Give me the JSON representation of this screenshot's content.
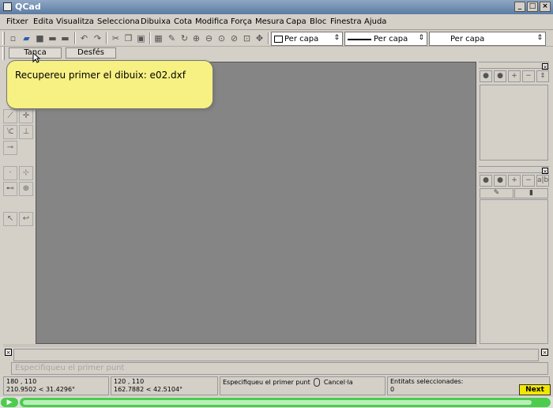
{
  "window": {
    "title": "QCad"
  },
  "menu": [
    "Fitxer",
    "Edita",
    "Visualitza",
    "Selecciona",
    "Dibuixa",
    "Cota",
    "Modifica",
    "Força",
    "Mesura",
    "Capa",
    "Bloc",
    "Finestra",
    "Ajuda"
  ],
  "toolbar": {
    "color_combo": "Per capa",
    "linetype_combo": "Per capa",
    "width_combo": "Per capa"
  },
  "cmdbar": {
    "close_label": "Tanca",
    "undo_label": "Desfés"
  },
  "tooltip": {
    "message": "Recupereu primer el dibuix: e02.dxf"
  },
  "command_line": {
    "placeholder": "Especifiqueu el primer punt"
  },
  "status": {
    "abs_coord": "180 , 110",
    "abs_polar": "210.9502 < 31.4296°",
    "rel_coord": "120 , 110",
    "rel_polar": "162.7882 < 42.5104°",
    "left_mouse": "Especifiqueu el primer punt",
    "right_mouse": "Cancel·la",
    "selected_label": "Entitats seleccionades:",
    "selected_count": "0"
  },
  "next_button": "Next",
  "player": {
    "progress": 0.97
  }
}
